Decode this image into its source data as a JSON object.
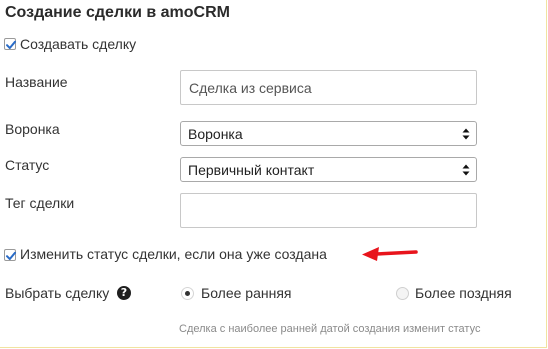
{
  "title": "Создание сделки в amoCRM",
  "create_deal": {
    "label": "Создавать сделку",
    "checked": true
  },
  "fields": {
    "name": {
      "label": "Название",
      "value": "Сделка из сервиса"
    },
    "pipeline": {
      "label": "Воронка",
      "value": "Воронка"
    },
    "status": {
      "label": "Статус",
      "value": "Первичный контакт"
    },
    "tag": {
      "label": "Тег сделки",
      "value": ""
    }
  },
  "change_status": {
    "label": "Изменить статус сделки, если она уже создана",
    "checked": true
  },
  "select_deal": {
    "label": "Выбрать сделку",
    "help_icon_glyph": "?",
    "options": [
      {
        "label": "Более ранняя",
        "selected": true
      },
      {
        "label": "Более поздняя",
        "selected": false
      }
    ],
    "hint": "Сделка с наиболее ранней датой создания изменит статус"
  },
  "colors": {
    "panel_border": "#f1e3a0",
    "arrow": "#e8141c",
    "checkbox_mark": "#2a6cc7"
  },
  "icons": {
    "checkbox": "checkmark-icon",
    "select": "select-arrows-icon",
    "help": "help-icon",
    "pointer": "red-arrow-icon"
  }
}
